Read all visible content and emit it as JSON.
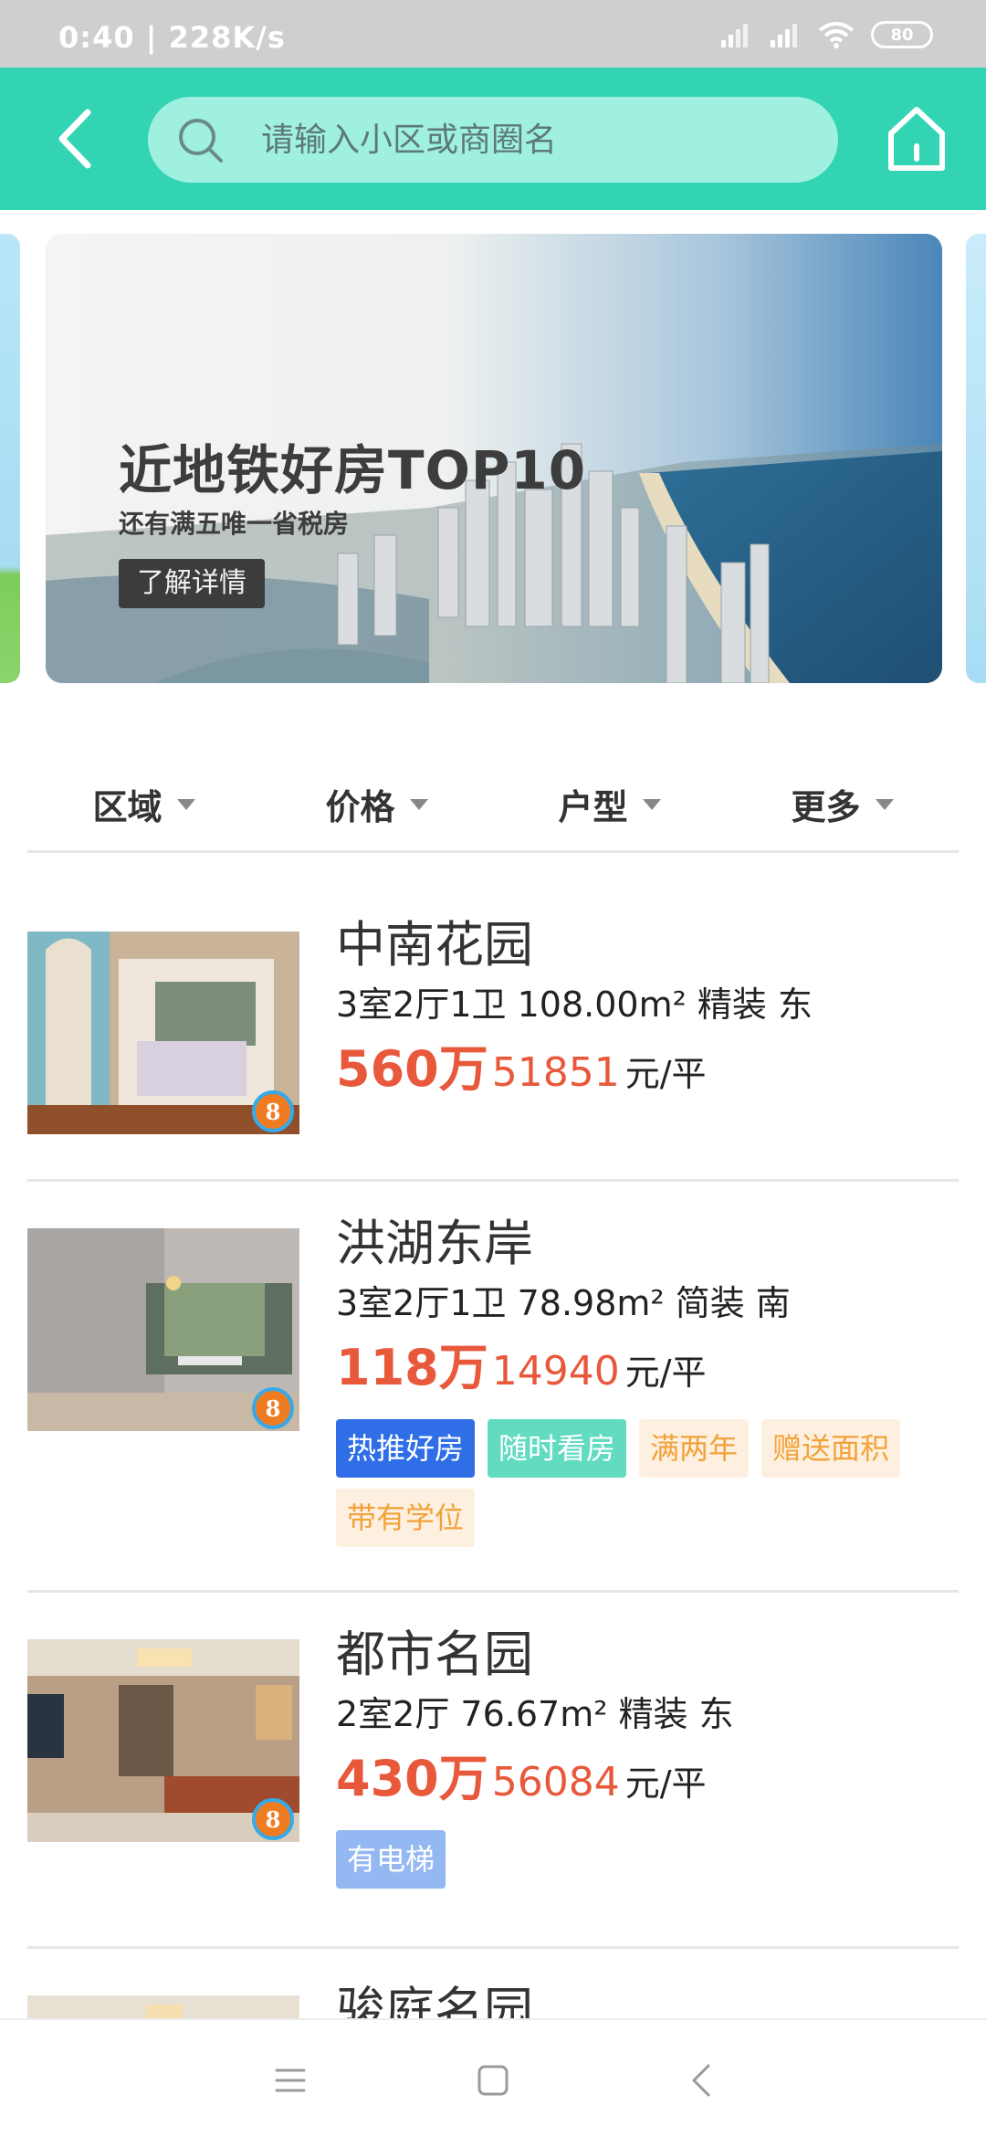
{
  "status_bar": {
    "time_speed": "0:40 | 228K/s",
    "battery": "80"
  },
  "search": {
    "placeholder": "请输入小区或商圈名"
  },
  "banner": {
    "title": "近地铁好房TOP10",
    "subtitle": "还有满五唯一省税房",
    "button": "了解详情"
  },
  "filters": [
    {
      "label": "区域"
    },
    {
      "label": "价格"
    },
    {
      "label": "户型"
    },
    {
      "label": "更多"
    }
  ],
  "listings": [
    {
      "name": "中南花园",
      "detail": "3室2厅1卫 108.00m² 精装 东",
      "price_total": "560万",
      "price_unit": "51851",
      "unit_label": "元/平",
      "badge": "8",
      "tags": []
    },
    {
      "name": "洪湖东岸",
      "detail": "3室2厅1卫 78.98m² 简装 南",
      "price_total": "118万",
      "price_unit": "14940",
      "unit_label": "元/平",
      "badge": "8",
      "tags": [
        "热推好房",
        "随时看房",
        "满两年",
        "赠送面积",
        "带有学位"
      ]
    },
    {
      "name": "都市名园",
      "detail": "2室2厅 76.67m² 精装 东",
      "price_total": "430万",
      "price_unit": "56084",
      "unit_label": "元/平",
      "badge": "8",
      "tags": [
        "有电梯"
      ]
    },
    {
      "name": "骏庭名园"
    }
  ],
  "colors": {
    "header": "#32d4b3",
    "search_bg": "#9ff0df",
    "price": "#e8583b",
    "tag_blue": "#2f6ee6",
    "tag_teal": "#62dbc0",
    "tag_orange_text": "#f2a23a",
    "tag_lightblue": "#94b8f1"
  },
  "nav_icons": [
    "menu-icon",
    "square-icon",
    "back-triangle-icon"
  ]
}
